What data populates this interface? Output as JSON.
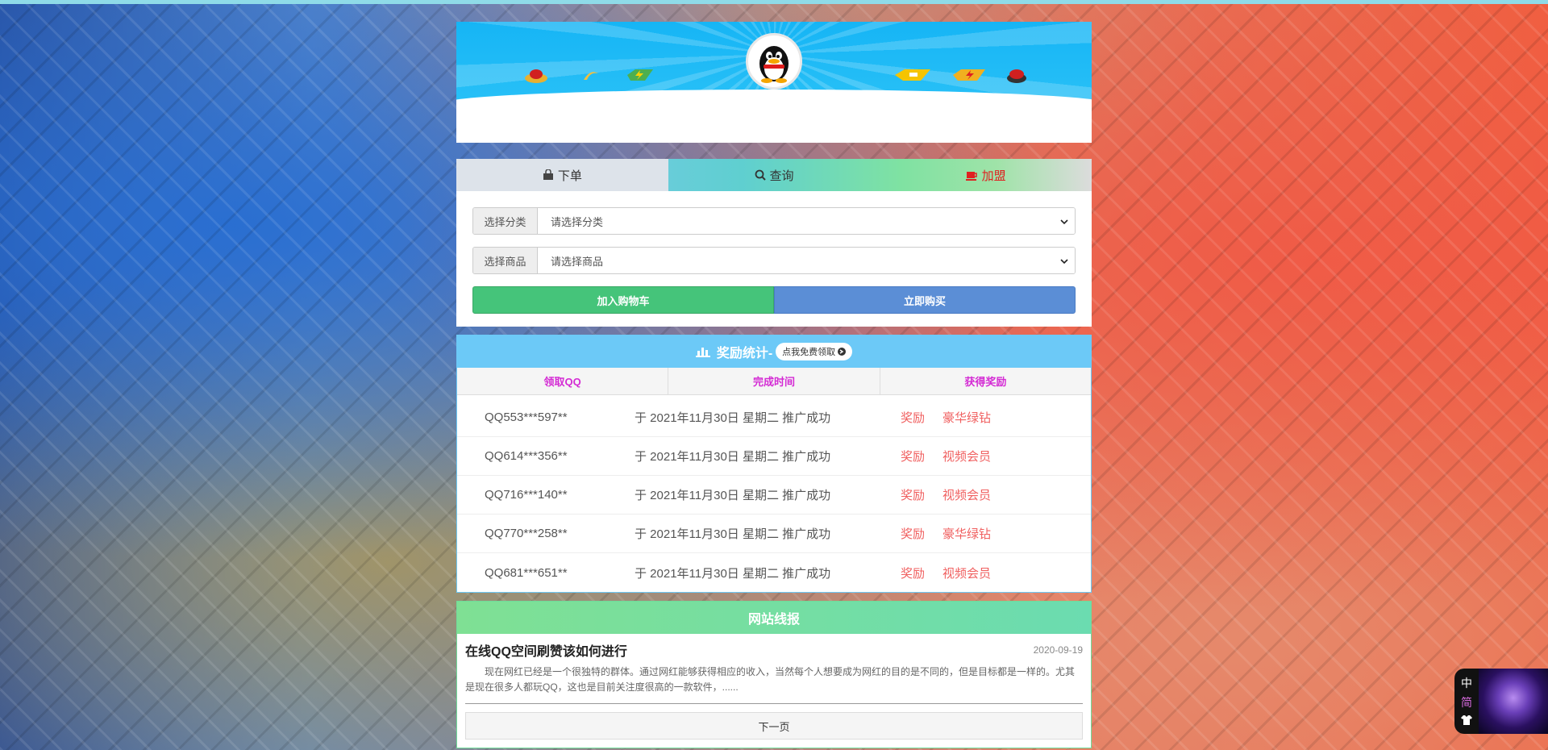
{
  "tabs": [
    {
      "label": "下单",
      "icon": "bag-icon"
    },
    {
      "label": "查询",
      "icon": "search-icon"
    },
    {
      "label": "加盟",
      "icon": "cup-icon"
    }
  ],
  "order_form": {
    "category_label": "选择分类",
    "category_value": "请选择分类",
    "product_label": "选择商品",
    "product_value": "请选择商品",
    "add_cart_label": "加入购物车",
    "buy_now_label": "立即购买"
  },
  "stats": {
    "title": "奖励统计-",
    "free_button": "点我免费领取",
    "columns": [
      "领取QQ",
      "完成时间",
      "获得奖励"
    ],
    "rows": [
      {
        "qq": "QQ553***597**",
        "time": "于 2021年11月30日 星期二 推广成功",
        "reward_label": "奖励",
        "reward": "豪华绿钻"
      },
      {
        "qq": "QQ614***356**",
        "time": "于 2021年11月30日 星期二 推广成功",
        "reward_label": "奖励",
        "reward": "视频会员"
      },
      {
        "qq": "QQ716***140**",
        "time": "于 2021年11月30日 星期二 推广成功",
        "reward_label": "奖励",
        "reward": "视频会员"
      },
      {
        "qq": "QQ770***258**",
        "time": "于 2021年11月30日 星期二 推广成功",
        "reward_label": "奖励",
        "reward": "豪华绿钻"
      },
      {
        "qq": "QQ681***651**",
        "time": "于 2021年11月30日 星期二 推广成功",
        "reward_label": "奖励",
        "reward": "视频会员"
      }
    ]
  },
  "news": {
    "header": "网站线报",
    "title": "在线QQ空间刷赞该如何进行",
    "date": "2020-09-19",
    "text": "现在网红已经是一个很独特的群体。通过网红能够获得相应的收入，当然每个人想要成为网红的目的是不同的，但是目标都是一样的。尤其是现在很多人都玩QQ，这也是目前关注度很高的一款软件，......",
    "next_button": "下一页"
  },
  "widget": {
    "lang": "中",
    "punct": "简"
  },
  "colors": {
    "cart_button": "#45c47a",
    "buy_button": "#5b8ed6",
    "stats_header": "#6cc9f7",
    "column_header_text": "#d42bd4",
    "reward_text": "#f06060",
    "join_tab_text": "#e02020"
  }
}
